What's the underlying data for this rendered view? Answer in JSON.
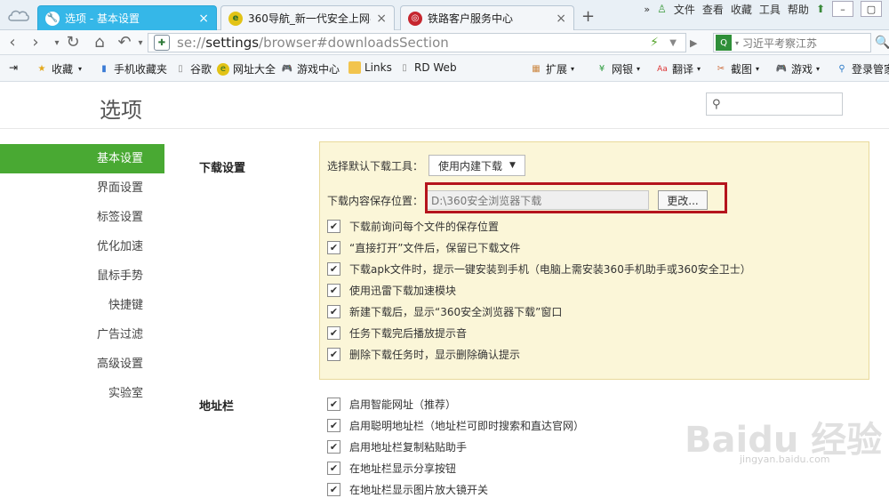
{
  "tabs": [
    {
      "label": "选项 - 基本设置",
      "active": true
    },
    {
      "label": "360导航_新一代安全上网导",
      "active": false
    },
    {
      "label": "铁路客户服务中心",
      "active": false
    }
  ],
  "menu": [
    "文件",
    "查看",
    "收藏",
    "工具",
    "帮助"
  ],
  "address": {
    "scheme": "se://",
    "host": "settings",
    "path": "/browser#downloadsSection"
  },
  "search": {
    "value": "习近平考察江苏"
  },
  "bookmarks": [
    {
      "label": "收藏"
    },
    {
      "label": "手机收藏夹"
    },
    {
      "label": "谷歌"
    },
    {
      "label": "网址大全"
    },
    {
      "label": "游戏中心"
    },
    {
      "label": "Links"
    },
    {
      "label": "RD Web"
    }
  ],
  "toolbar": [
    {
      "label": "扩展"
    },
    {
      "label": "网银"
    },
    {
      "label": "翻译"
    },
    {
      "label": "截图"
    },
    {
      "label": "游戏"
    },
    {
      "label": "登录管家"
    }
  ],
  "page": {
    "title": "选项"
  },
  "sidebar": {
    "items": [
      {
        "label": "基本设置",
        "active": true
      },
      {
        "label": "界面设置"
      },
      {
        "label": "标签设置"
      },
      {
        "label": "优化加速"
      },
      {
        "label": "鼠标手势"
      },
      {
        "label": "快捷键"
      },
      {
        "label": "广告过滤"
      },
      {
        "label": "高级设置"
      },
      {
        "label": "实验室"
      }
    ]
  },
  "download": {
    "section_title": "下载设置",
    "tool_label": "选择默认下载工具：",
    "tool_value": "使用内建下载",
    "path_label": "下载内容保存位置：",
    "path_value": "D:\\360安全浏览器下载",
    "change_label": "更改...",
    "options": [
      "下载前询问每个文件的保存位置",
      "“直接打开”文件后，保留已下载文件",
      "下载apk文件时，提示一键安装到手机（电脑上需安装360手机助手或360安全卫士）",
      "使用迅雷下载加速模块",
      "新建下载后，显示“360安全浏览器下载”窗口",
      "任务下载完后播放提示音",
      "删除下载任务时，显示删除确认提示"
    ]
  },
  "address_bar_section": {
    "title": "地址栏",
    "options": [
      "启用智能网址（推荐）",
      "启用聪明地址栏（地址栏可即时搜索和直达官网）",
      "启用地址栏复制粘贴助手",
      "在地址栏显示分享按钮",
      "在地址栏显示图片放大镜开关"
    ]
  },
  "watermark": {
    "logo": "Baidu 经验",
    "site": "jingyan.baidu.com"
  }
}
